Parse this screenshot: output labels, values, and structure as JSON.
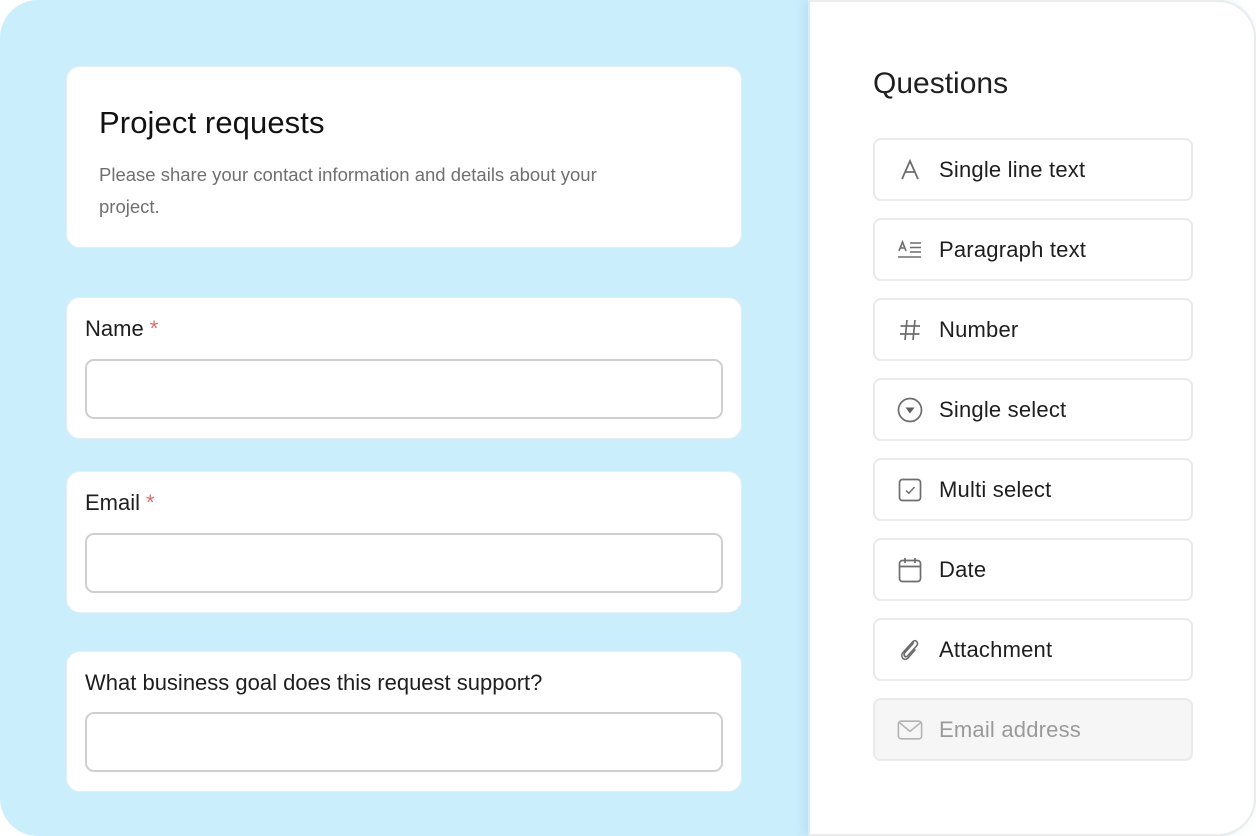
{
  "form": {
    "title": "Project requests",
    "description": "Please share your contact information and details about your project.",
    "questions": [
      {
        "label": "Name",
        "required_mark": "*",
        "value": ""
      },
      {
        "label": "Email",
        "required_mark": "*",
        "value": ""
      },
      {
        "label": "What business goal does this request support?",
        "required_mark": "",
        "value": ""
      }
    ]
  },
  "panel": {
    "title": "Questions",
    "types": [
      {
        "label": "Single line text",
        "icon": "letter-a-icon"
      },
      {
        "label": "Paragraph text",
        "icon": "paragraph-text-icon"
      },
      {
        "label": "Number",
        "icon": "hash-icon"
      },
      {
        "label": "Single select",
        "icon": "dropdown-circle-icon"
      },
      {
        "label": "Multi select",
        "icon": "checkbox-icon"
      },
      {
        "label": "Date",
        "icon": "calendar-icon"
      },
      {
        "label": "Attachment",
        "icon": "paperclip-icon"
      },
      {
        "label": "Email address",
        "icon": "envelope-icon",
        "disabled": true
      }
    ]
  },
  "colors": {
    "canvas_bg": "#cbeefd",
    "required": "#dd6b6b",
    "muted_text": "#6f6f6f"
  }
}
